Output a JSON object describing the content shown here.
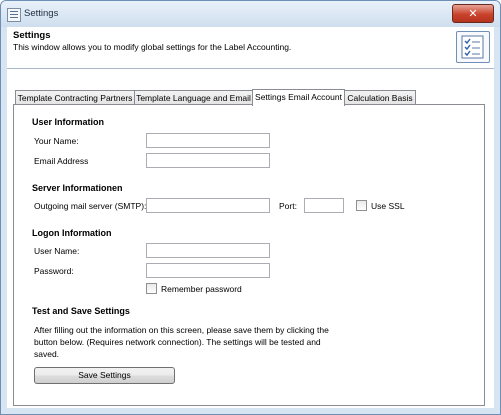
{
  "window": {
    "title": "Settings",
    "close_symbol": "✕"
  },
  "header": {
    "title": "Settings",
    "description": "This window allows you to modify global settings for the Label Accounting."
  },
  "tabs": [
    {
      "label": "Template Contracting Partners",
      "active": false
    },
    {
      "label": "Template Language and Email",
      "active": false
    },
    {
      "label": "Settings Email Account",
      "active": true
    },
    {
      "label": "Calculation Basis",
      "active": false
    }
  ],
  "user_info": {
    "title": "User Information",
    "your_name_label": "Your Name:",
    "your_name_value": "",
    "email_label": "Email Address",
    "email_value": ""
  },
  "server_info": {
    "title": "Server Informationen",
    "smtp_label": "Outgoing mail server (SMTP):",
    "smtp_value": "",
    "port_label": "Port:",
    "port_value": "",
    "ssl_label": "Use SSL",
    "ssl_checked": false
  },
  "logon_info": {
    "title": "Logon Information",
    "username_label": "User Name:",
    "username_value": "",
    "password_label": "Password:",
    "password_value": "",
    "remember_label": "Remember password",
    "remember_checked": false
  },
  "test_save": {
    "title": "Test and Save Settings",
    "description": "After filling out the information on this screen, please save them by clicking the button below. (Requires network connection). The settings will be tested and saved.",
    "button_label": "Save Settings"
  }
}
